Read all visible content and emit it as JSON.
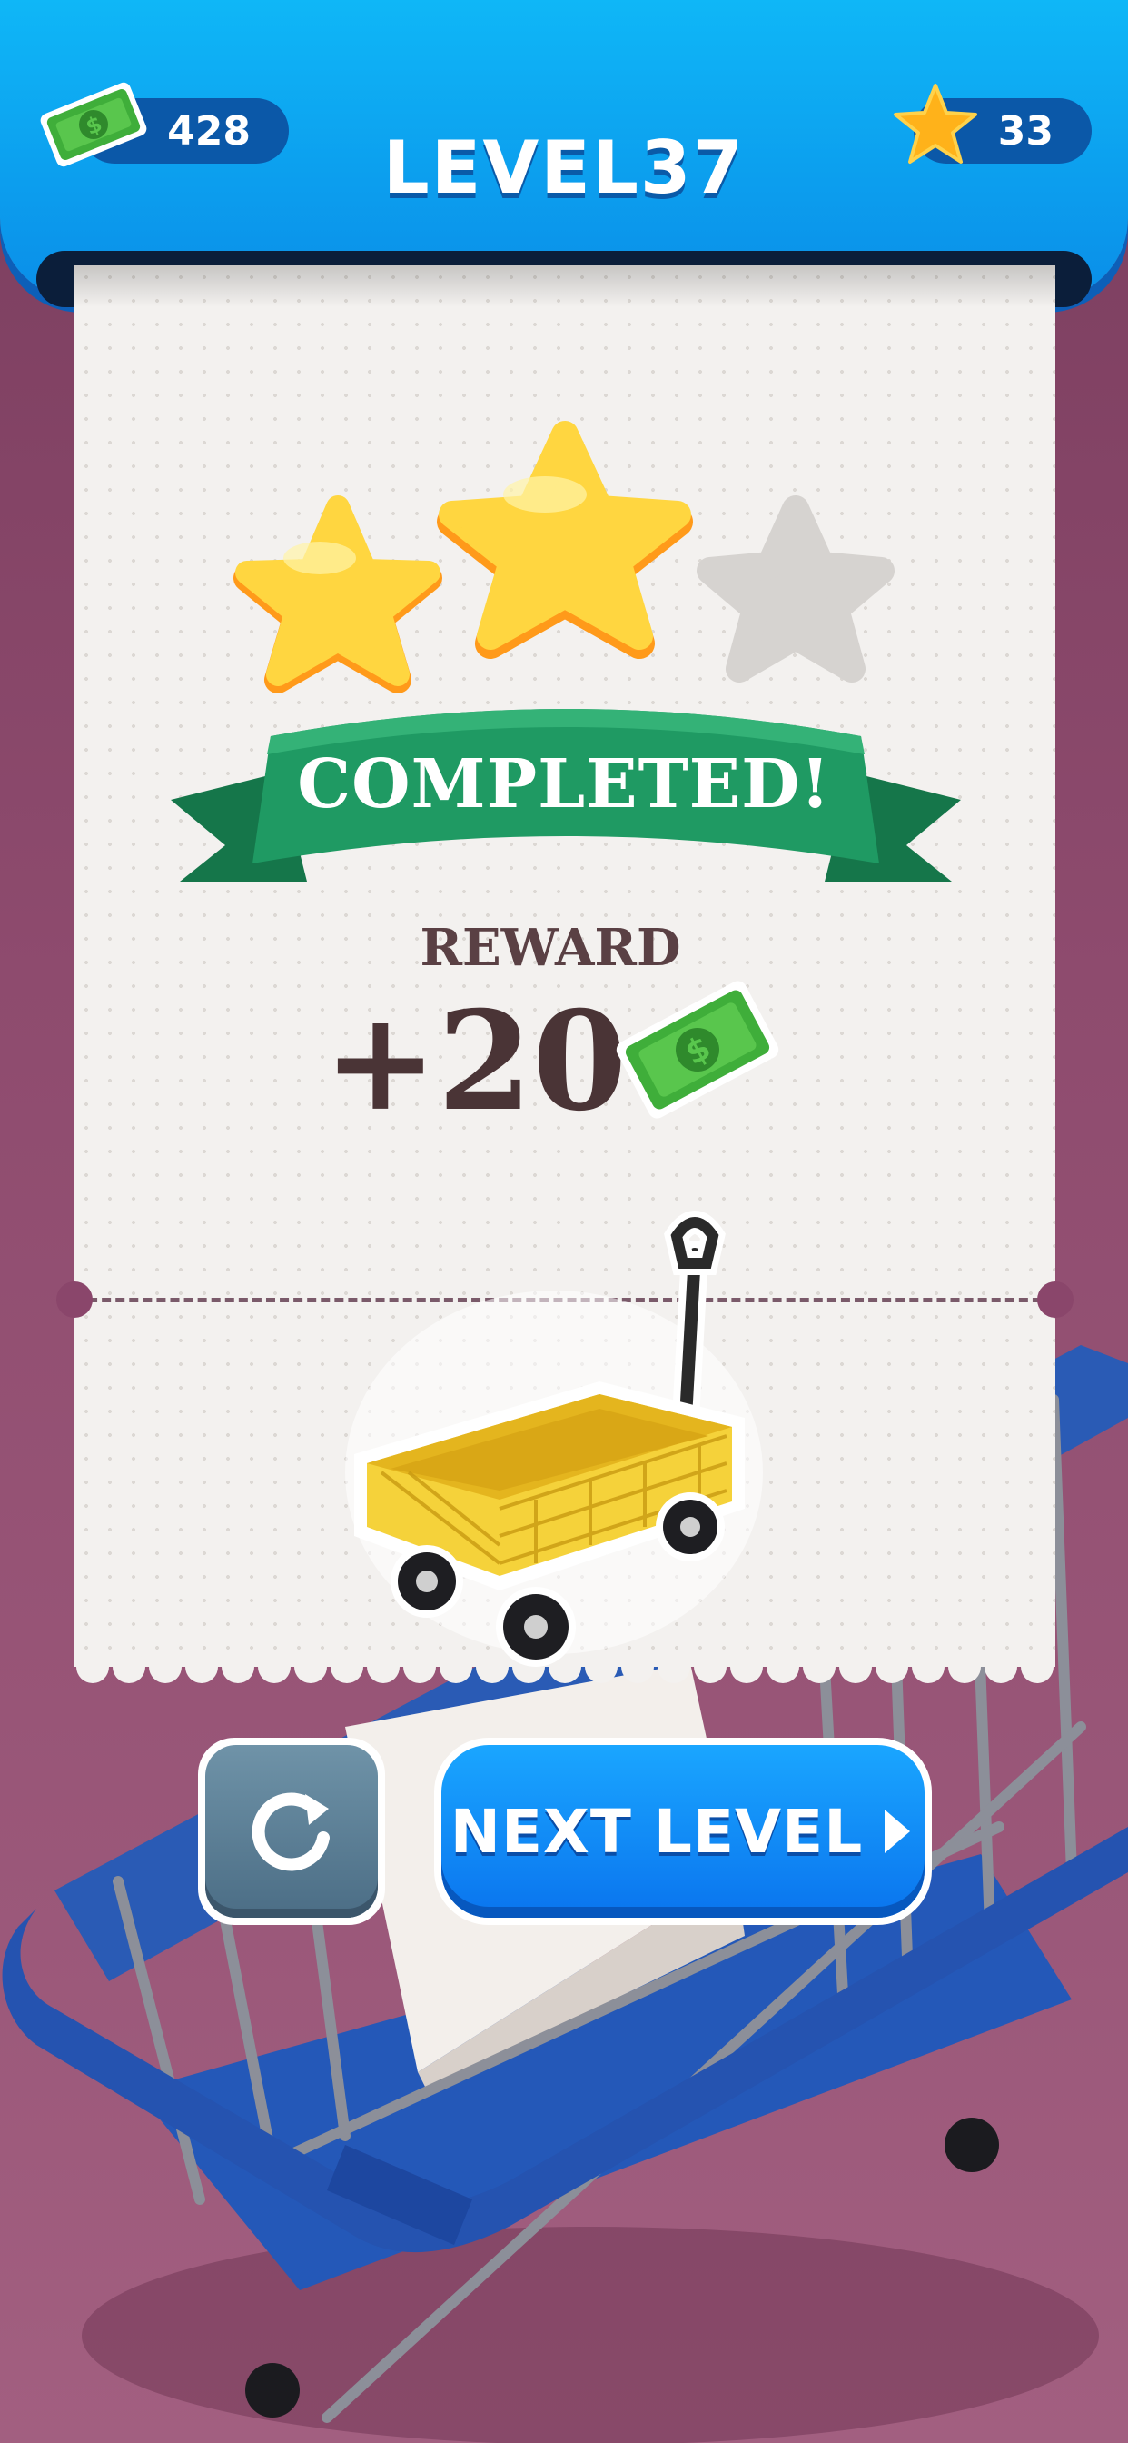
{
  "hud": {
    "cash_count": "428",
    "star_count": "33",
    "level_title": "LEVEL37"
  },
  "result": {
    "stars_earned": 2,
    "stars_total": 3,
    "banner_text": "COMPLETED!",
    "reward_label": "REWARD",
    "reward_amount": "+20"
  },
  "buttons": {
    "next_level_label": "NEXT LEVEL"
  },
  "icons": {
    "cash": "cash-bill-icon",
    "star": "star-icon",
    "restart": "restart-icon",
    "play": "play-triangle-icon",
    "unlocked_item": "wagon-cart-icon"
  },
  "colors": {
    "header_blue": "#0a8ee8",
    "banner_green": "#1f9a63",
    "star_gold": "#ffc21a",
    "star_empty": "#d6d3d0",
    "button_blue": "#0a74ee",
    "button_restart": "#55788f"
  }
}
